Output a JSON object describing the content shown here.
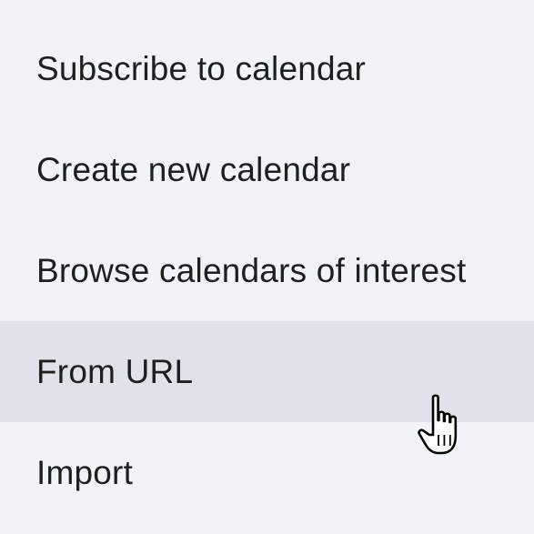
{
  "menu": {
    "items": [
      {
        "label": "Subscribe to calendar"
      },
      {
        "label": "Create new calendar"
      },
      {
        "label": "Browse calendars of interest"
      },
      {
        "label": "From URL",
        "hovered": true
      },
      {
        "label": "Import"
      }
    ]
  },
  "colors": {
    "background": "#f0f4f9",
    "hover_background": "#dfe3e9",
    "text": "#1f1f1f"
  },
  "cursor": {
    "icon": "hand-pointer-icon"
  }
}
